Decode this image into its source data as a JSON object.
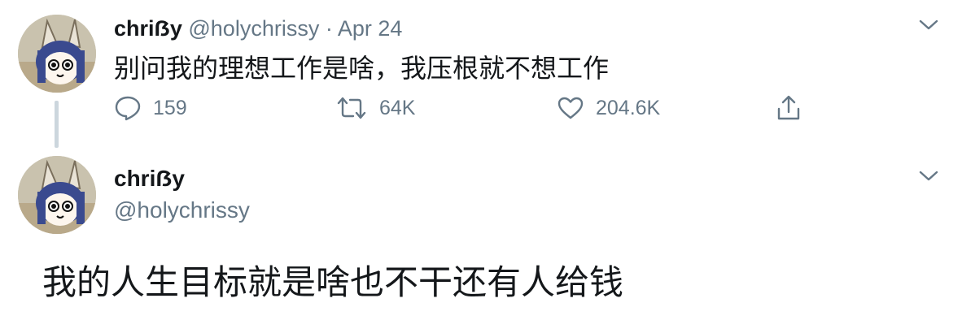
{
  "reply_tweet": {
    "display_name": "chriẞy",
    "handle": "@holychrissy",
    "separator": "·",
    "date": "Apr 24",
    "text": "别问我的理想工作是啥，我压根就不想工作",
    "actions": {
      "reply_icon": "speech-bubble-icon",
      "reply_count": "159",
      "retweet_icon": "retweet-icon",
      "retweet_count": "64K",
      "like_icon": "heart-icon",
      "like_count": "204.6K",
      "share_icon": "share-upload-icon"
    },
    "menu_icon": "chevron-down-icon"
  },
  "main_tweet": {
    "display_name": "chriẞy",
    "handle": "@holychrissy",
    "text": "我的人生目标就是啥也不干还有人给钱",
    "menu_icon": "chevron-down-icon"
  },
  "colors": {
    "text": "#14171a",
    "muted": "#657786",
    "thread_line": "#ccd6dd",
    "avatar_hair": "#3a4a8f",
    "avatar_bg": "#c9c2ae"
  }
}
